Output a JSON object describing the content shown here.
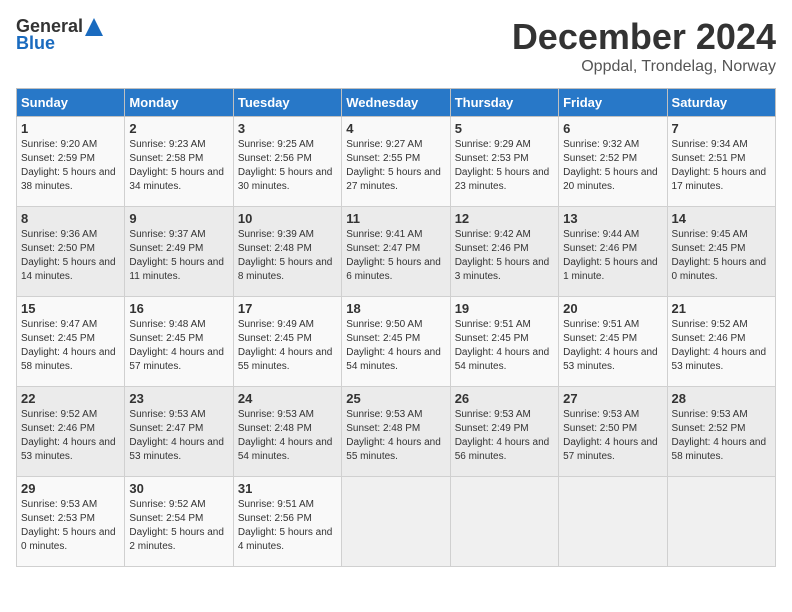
{
  "header": {
    "logo_general": "General",
    "logo_blue": "Blue",
    "month": "December 2024",
    "location": "Oppdal, Trondelag, Norway"
  },
  "calendar": {
    "days_of_week": [
      "Sunday",
      "Monday",
      "Tuesday",
      "Wednesday",
      "Thursday",
      "Friday",
      "Saturday"
    ],
    "weeks": [
      [
        null,
        {
          "day": "2",
          "sunrise": "9:23 AM",
          "sunset": "2:58 PM",
          "daylight": "5 hours and 34 minutes."
        },
        {
          "day": "3",
          "sunrise": "9:25 AM",
          "sunset": "2:56 PM",
          "daylight": "5 hours and 30 minutes."
        },
        {
          "day": "4",
          "sunrise": "9:27 AM",
          "sunset": "2:55 PM",
          "daylight": "5 hours and 27 minutes."
        },
        {
          "day": "5",
          "sunrise": "9:29 AM",
          "sunset": "2:53 PM",
          "daylight": "5 hours and 23 minutes."
        },
        {
          "day": "6",
          "sunrise": "9:32 AM",
          "sunset": "2:52 PM",
          "daylight": "5 hours and 20 minutes."
        },
        {
          "day": "7",
          "sunrise": "9:34 AM",
          "sunset": "2:51 PM",
          "daylight": "5 hours and 17 minutes."
        }
      ],
      [
        {
          "day": "1",
          "sunrise": "9:20 AM",
          "sunset": "2:59 PM",
          "daylight": "5 hours and 38 minutes."
        },
        {
          "day": "9",
          "sunrise": "9:37 AM",
          "sunset": "2:49 PM",
          "daylight": "5 hours and 11 minutes."
        },
        {
          "day": "10",
          "sunrise": "9:39 AM",
          "sunset": "2:48 PM",
          "daylight": "5 hours and 8 minutes."
        },
        {
          "day": "11",
          "sunrise": "9:41 AM",
          "sunset": "2:47 PM",
          "daylight": "5 hours and 6 minutes."
        },
        {
          "day": "12",
          "sunrise": "9:42 AM",
          "sunset": "2:46 PM",
          "daylight": "5 hours and 3 minutes."
        },
        {
          "day": "13",
          "sunrise": "9:44 AM",
          "sunset": "2:46 PM",
          "daylight": "5 hours and 1 minute."
        },
        {
          "day": "14",
          "sunrise": "9:45 AM",
          "sunset": "2:45 PM",
          "daylight": "5 hours and 0 minutes."
        }
      ],
      [
        {
          "day": "8",
          "sunrise": "9:36 AM",
          "sunset": "2:50 PM",
          "daylight": "5 hours and 14 minutes."
        },
        {
          "day": "16",
          "sunrise": "9:48 AM",
          "sunset": "2:45 PM",
          "daylight": "4 hours and 57 minutes."
        },
        {
          "day": "17",
          "sunrise": "9:49 AM",
          "sunset": "2:45 PM",
          "daylight": "4 hours and 55 minutes."
        },
        {
          "day": "18",
          "sunrise": "9:50 AM",
          "sunset": "2:45 PM",
          "daylight": "4 hours and 54 minutes."
        },
        {
          "day": "19",
          "sunrise": "9:51 AM",
          "sunset": "2:45 PM",
          "daylight": "4 hours and 54 minutes."
        },
        {
          "day": "20",
          "sunrise": "9:51 AM",
          "sunset": "2:45 PM",
          "daylight": "4 hours and 53 minutes."
        },
        {
          "day": "21",
          "sunrise": "9:52 AM",
          "sunset": "2:46 PM",
          "daylight": "4 hours and 53 minutes."
        }
      ],
      [
        {
          "day": "15",
          "sunrise": "9:47 AM",
          "sunset": "2:45 PM",
          "daylight": "4 hours and 58 minutes."
        },
        {
          "day": "23",
          "sunrise": "9:53 AM",
          "sunset": "2:47 PM",
          "daylight": "4 hours and 53 minutes."
        },
        {
          "day": "24",
          "sunrise": "9:53 AM",
          "sunset": "2:48 PM",
          "daylight": "4 hours and 54 minutes."
        },
        {
          "day": "25",
          "sunrise": "9:53 AM",
          "sunset": "2:48 PM",
          "daylight": "4 hours and 55 minutes."
        },
        {
          "day": "26",
          "sunrise": "9:53 AM",
          "sunset": "2:49 PM",
          "daylight": "4 hours and 56 minutes."
        },
        {
          "day": "27",
          "sunrise": "9:53 AM",
          "sunset": "2:50 PM",
          "daylight": "4 hours and 57 minutes."
        },
        {
          "day": "28",
          "sunrise": "9:53 AM",
          "sunset": "2:52 PM",
          "daylight": "4 hours and 58 minutes."
        }
      ],
      [
        {
          "day": "22",
          "sunrise": "9:52 AM",
          "sunset": "2:46 PM",
          "daylight": "4 hours and 53 minutes."
        },
        {
          "day": "30",
          "sunrise": "9:52 AM",
          "sunset": "2:54 PM",
          "daylight": "5 hours and 2 minutes."
        },
        {
          "day": "31",
          "sunrise": "9:51 AM",
          "sunset": "2:56 PM",
          "daylight": "5 hours and 4 minutes."
        },
        null,
        null,
        null,
        null
      ],
      [
        {
          "day": "29",
          "sunrise": "9:53 AM",
          "sunset": "2:53 PM",
          "daylight": "5 hours and 0 minutes."
        },
        null,
        null,
        null,
        null,
        null,
        null
      ]
    ]
  }
}
